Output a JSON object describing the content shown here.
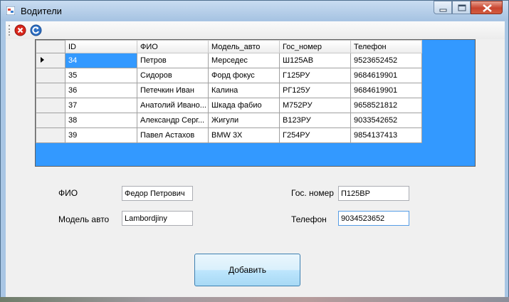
{
  "window": {
    "title": "Водители",
    "minimize_icon": "minimize-icon",
    "maximize_icon": "maximize-icon",
    "close_icon": "close-icon"
  },
  "toolbar": {
    "delete_icon": "delete-icon",
    "refresh_icon": "refresh-icon"
  },
  "grid": {
    "columns": [
      "ID",
      "ФИО",
      "Модель_авто",
      "Гос_номер",
      "Телефон"
    ],
    "rows": [
      {
        "id": "34",
        "fio": "Петров",
        "model": "Мерседес",
        "plate": "Ш125АВ",
        "phone": "9523652452"
      },
      {
        "id": "35",
        "fio": "Сидоров",
        "model": "Форд фокус",
        "plate": "Г125РУ",
        "phone": "9684619901"
      },
      {
        "id": "36",
        "fio": "Петечкин Иван",
        "model": "Калина",
        "plate": "РГ125У",
        "phone": "9684619901"
      },
      {
        "id": "37",
        "fio": "Анатолий Ивано...",
        "model": "Шкада фабио",
        "plate": "М752РУ",
        "phone": "9658521812"
      },
      {
        "id": "38",
        "fio": "Александр Серг...",
        "model": "Жигули",
        "plate": "В123РУ",
        "phone": "9033542652"
      },
      {
        "id": "39",
        "fio": "Павел Астахов",
        "model": "BMW 3X",
        "plate": "Г254РУ",
        "phone": "9854137413"
      }
    ],
    "selected_row": 0,
    "accent_color": "#3399ff"
  },
  "form": {
    "fio_label": "ФИО",
    "fio_value": "Федор Петрович",
    "model_label": "Модель авто",
    "model_value": "Lambordjiny",
    "plate_label": "Гос. номер",
    "plate_value": "П125ВР",
    "phone_label": "Телефон",
    "phone_value": "9034523652",
    "add_button": "Добавить"
  }
}
